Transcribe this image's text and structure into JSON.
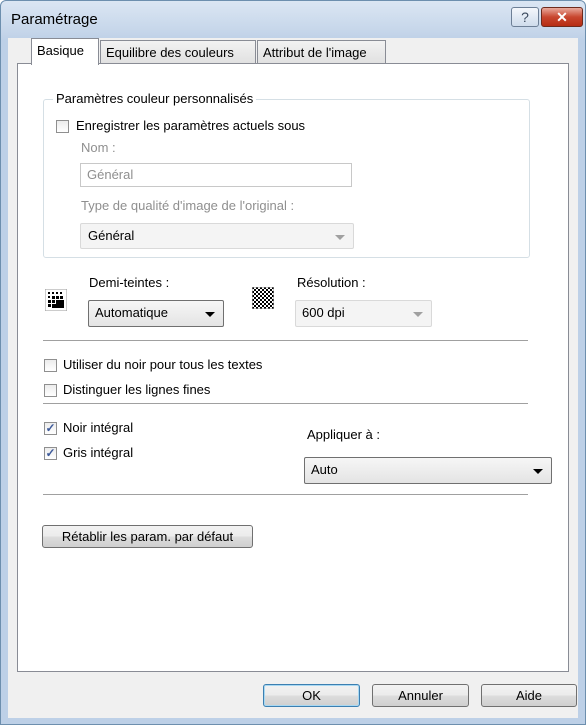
{
  "window": {
    "title": "Paramétrage",
    "help_glyph": "?",
    "close_glyph": "✕"
  },
  "tabs": [
    {
      "label": "Basique"
    },
    {
      "label": "Equilibre des couleurs"
    },
    {
      "label": "Attribut de l'image"
    }
  ],
  "custom_color": {
    "legend": "Paramètres couleur personnalisés",
    "save_checkbox_label": "Enregistrer les paramètres actuels sous",
    "save_checked": false,
    "name_label": "Nom :",
    "name_value": "Général",
    "quality_label": "Type de qualité d'image de l'original :",
    "quality_value": "Général"
  },
  "halftone": {
    "label": "Demi-teintes :",
    "value": "Automatique",
    "icon": "halftone-pattern-icon"
  },
  "resolution": {
    "label": "Résolution :",
    "value": "600 dpi",
    "icon": "checkerboard-icon"
  },
  "options": {
    "black_text_label": "Utiliser du noir pour tous les textes",
    "black_text_checked": false,
    "fine_lines_label": "Distinguer les lignes fines",
    "fine_lines_checked": false,
    "pure_black_label": "Noir intégral",
    "pure_black_checked": true,
    "pure_gray_label": "Gris intégral",
    "pure_gray_checked": true,
    "apply_to_label": "Appliquer à :",
    "apply_to_value": "Auto"
  },
  "buttons": {
    "reset_label": "Rétablir les param. par défaut",
    "ok_label": "OK",
    "cancel_label": "Annuler",
    "help_label": "Aide"
  },
  "check_glyph": "✓"
}
